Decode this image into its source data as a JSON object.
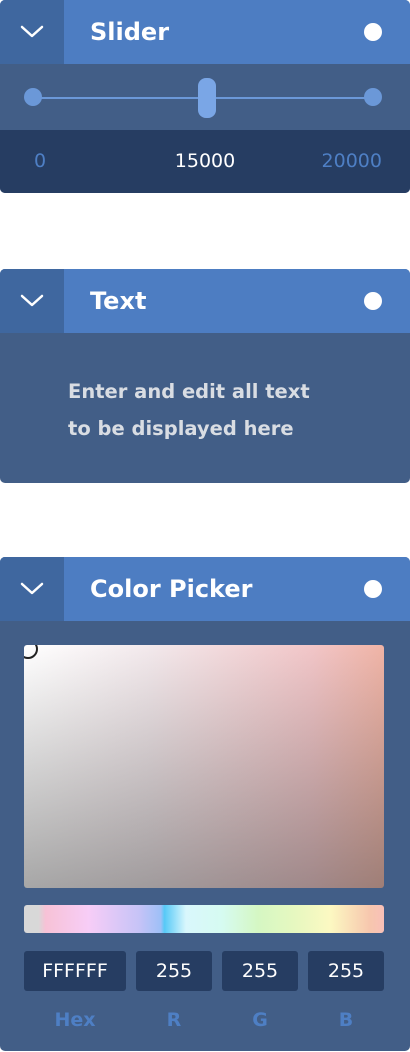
{
  "slider_panel": {
    "title": "Slider",
    "min_label": "0",
    "value_label": "15000",
    "max_label": "20000",
    "min": 0,
    "max": 20000,
    "value": 15000
  },
  "text_panel": {
    "title": "Text",
    "body_line1": "Enter and edit all text",
    "body_line2": "to be displayed here"
  },
  "color_panel": {
    "title": "Color Picker",
    "hex_value": "FFFFFF",
    "r_value": "255",
    "g_value": "255",
    "b_value": "255",
    "hex_label": "Hex",
    "r_label": "R",
    "g_label": "G",
    "b_label": "B"
  },
  "colors": {
    "header": "#4d7dc2",
    "collapse_button": "#3f679f",
    "panel_body": "#425e87",
    "dark_strip": "#263d62",
    "accent_text": "#4e7fc4"
  },
  "icons": {
    "collapse": "chevron-down-icon",
    "status": "status-dot-icon"
  }
}
